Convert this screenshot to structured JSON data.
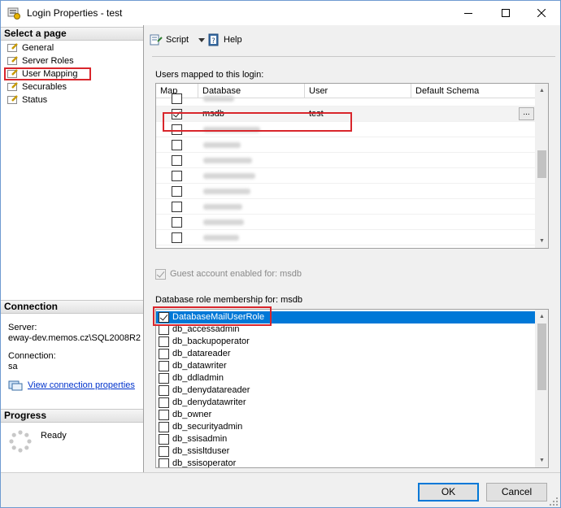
{
  "window": {
    "title": "Login Properties - test"
  },
  "left": {
    "select_page_header": "Select a page",
    "pages": [
      {
        "label": "General"
      },
      {
        "label": "Server Roles"
      },
      {
        "label": "User Mapping",
        "selected": true
      },
      {
        "label": "Securables"
      },
      {
        "label": "Status"
      }
    ],
    "connection_header": "Connection",
    "server_label": "Server:",
    "server_value": "eway-dev.memos.cz\\SQL2008R2",
    "connection_label": "Connection:",
    "connection_value": "sa",
    "view_connection_link": "View connection properties",
    "progress_header": "Progress",
    "progress_status": "Ready"
  },
  "toolbar": {
    "script_label": "Script",
    "help_label": "Help"
  },
  "users_mapped": {
    "label": "Users mapped to this login:",
    "columns": [
      "Map",
      "Database",
      "User",
      "Default Schema"
    ],
    "rows": [
      {
        "checked": false,
        "database": "",
        "user": "",
        "blurred": true
      },
      {
        "checked": true,
        "database": "msdb",
        "user": "test",
        "blurred": false
      },
      {
        "checked": false,
        "database": "",
        "user": "",
        "blurred": true
      },
      {
        "checked": false,
        "database": "",
        "user": "",
        "blurred": true
      },
      {
        "checked": false,
        "database": "",
        "user": "",
        "blurred": true
      },
      {
        "checked": false,
        "database": "",
        "user": "",
        "blurred": true
      },
      {
        "checked": false,
        "database": "",
        "user": "",
        "blurred": true
      },
      {
        "checked": false,
        "database": "",
        "user": "",
        "blurred": true
      },
      {
        "checked": false,
        "database": "",
        "user": "",
        "blurred": true
      },
      {
        "checked": false,
        "database": "",
        "user": "",
        "blurred": true
      }
    ],
    "ellipsis_label": "..."
  },
  "guest_account_label": "Guest account enabled for: msdb",
  "role_membership": {
    "label": "Database role membership for: msdb",
    "roles": [
      {
        "name": "DatabaseMailUserRole",
        "checked": true,
        "selected": true
      },
      {
        "name": "db_accessadmin",
        "checked": false
      },
      {
        "name": "db_backupoperator",
        "checked": false
      },
      {
        "name": "db_datareader",
        "checked": false
      },
      {
        "name": "db_datawriter",
        "checked": false
      },
      {
        "name": "db_ddladmin",
        "checked": false
      },
      {
        "name": "db_denydatareader",
        "checked": false
      },
      {
        "name": "db_denydatawriter",
        "checked": false
      },
      {
        "name": "db_owner",
        "checked": false
      },
      {
        "name": "db_securityadmin",
        "checked": false
      },
      {
        "name": "db_ssisadmin",
        "checked": false
      },
      {
        "name": "db_ssisltduser",
        "checked": false
      },
      {
        "name": "db_ssisoperator",
        "checked": false
      }
    ]
  },
  "buttons": {
    "ok": "OK",
    "cancel": "Cancel"
  },
  "colors": {
    "selection": "#0078d7",
    "highlight_box": "#d9262c",
    "link": "#0033cc"
  }
}
